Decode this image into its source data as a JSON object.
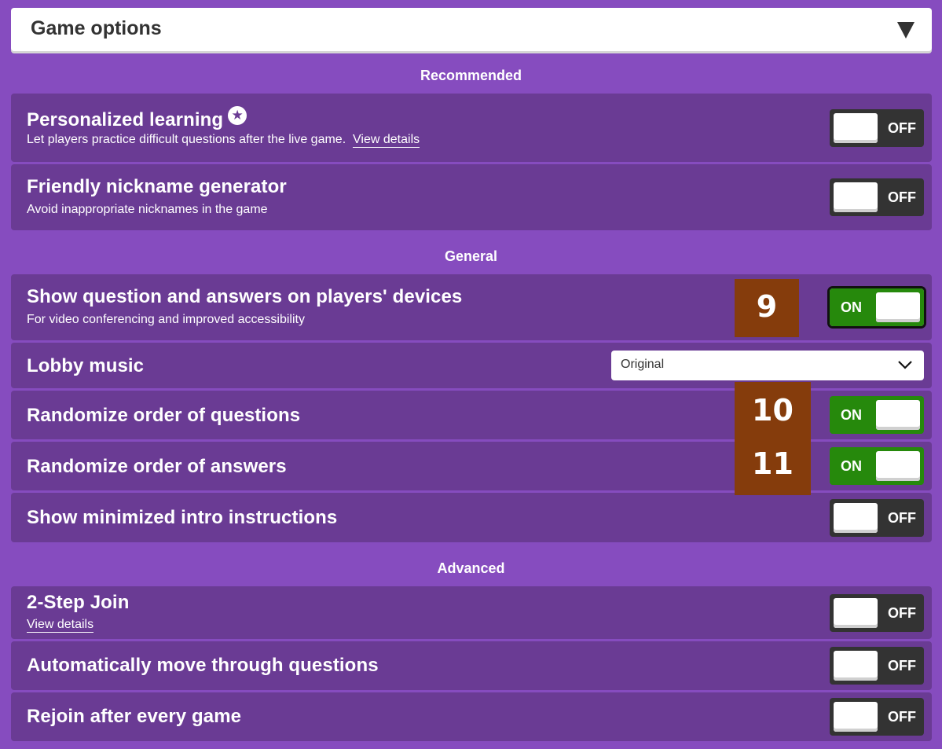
{
  "header": {
    "title": "Game options",
    "toggle_icon": "caret-down-icon"
  },
  "sections": {
    "recommended": "Recommended",
    "general": "General",
    "advanced": "Advanced"
  },
  "options": {
    "personalized_learning": {
      "title": "Personalized learning",
      "icon": "star-badge-icon",
      "description": "Let players practice difficult questions after the live game.",
      "link": "View details",
      "state": "OFF"
    },
    "friendly_nickname": {
      "title": "Friendly nickname generator",
      "description": "Avoid inappropriate nicknames in the game",
      "state": "OFF"
    },
    "show_question": {
      "title": "Show question and answers on players' devices",
      "description": "For video conferencing and improved accessibility",
      "state": "ON"
    },
    "lobby_music": {
      "title": "Lobby music",
      "selected": "Original"
    },
    "randomize_questions": {
      "title": "Randomize order of questions",
      "state": "ON"
    },
    "randomize_answers": {
      "title": "Randomize order of answers",
      "state": "ON"
    },
    "minimized_intro": {
      "title": "Show minimized intro instructions",
      "state": "OFF"
    },
    "two_step_join": {
      "title": "2-Step Join",
      "link": "View details",
      "state": "OFF"
    },
    "auto_move": {
      "title": "Automatically move through questions",
      "state": "OFF"
    },
    "rejoin": {
      "title": "Rejoin after every game",
      "state": "OFF"
    }
  },
  "annotations": [
    "9",
    "10",
    "11"
  ],
  "colors": {
    "background": "#864cbf",
    "row": "#6a3b94",
    "toggle_on": "#26890c",
    "toggle_off": "#333333",
    "annotation": "#853c0c"
  }
}
